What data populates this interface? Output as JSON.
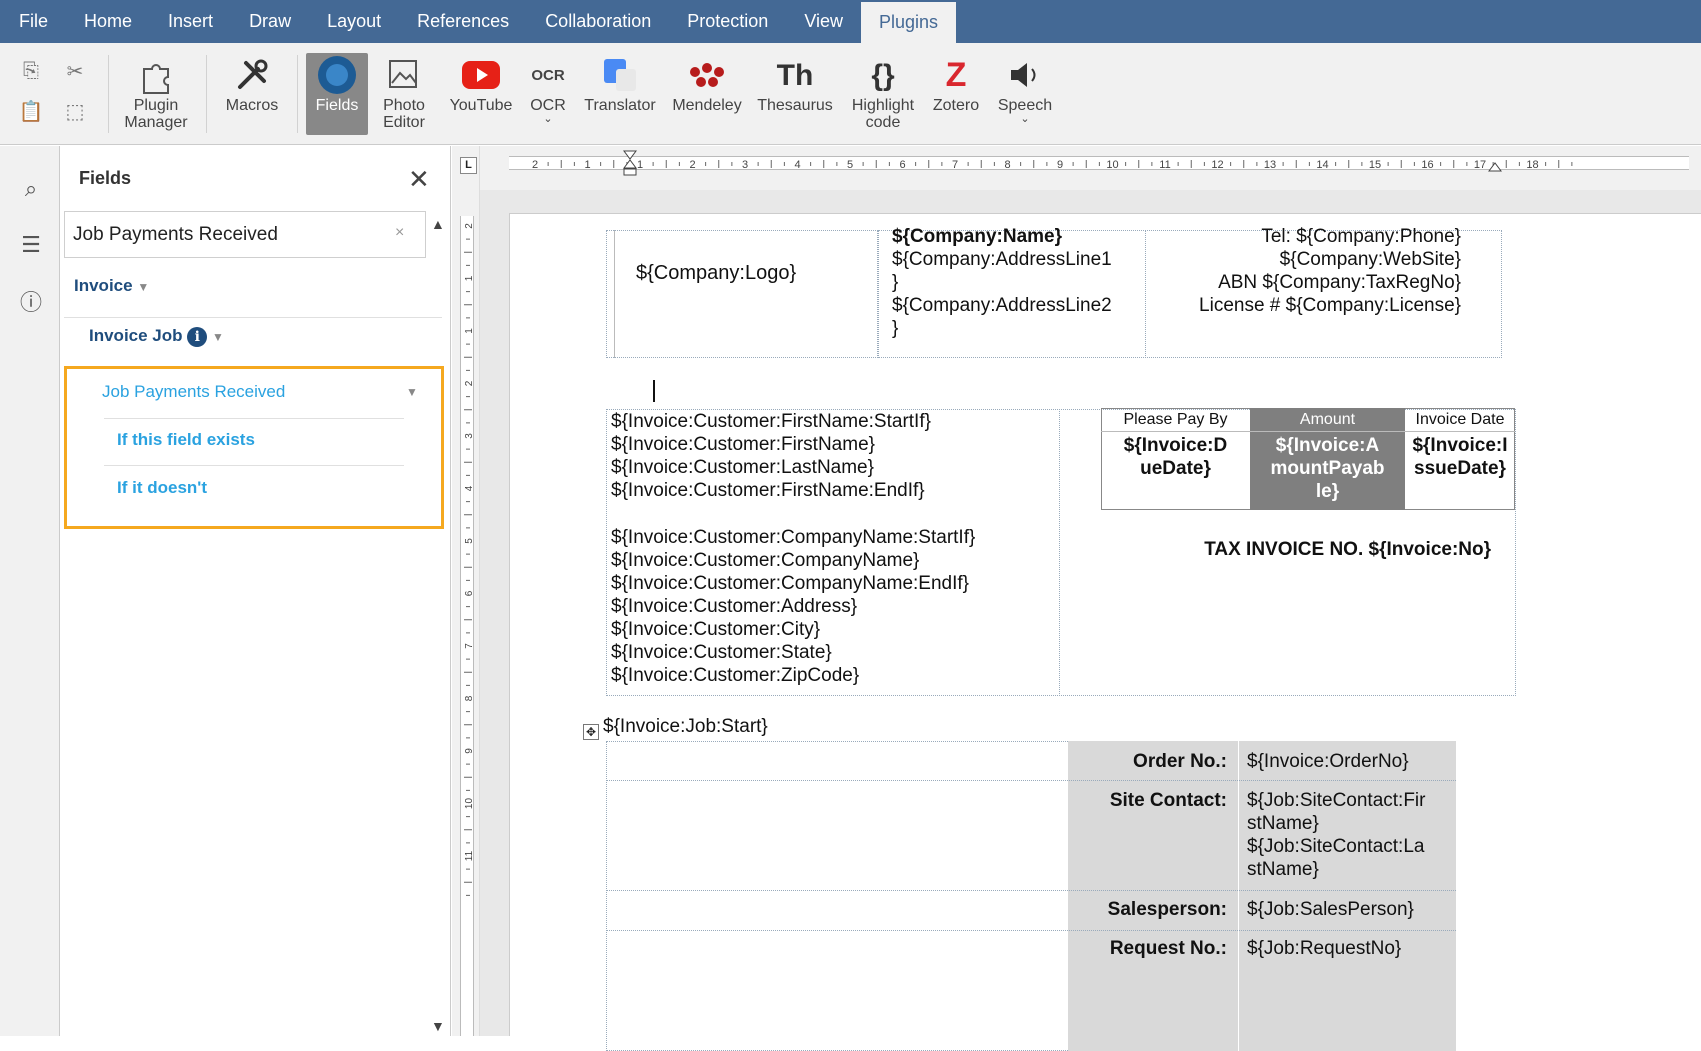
{
  "menu": {
    "tabs": [
      "File",
      "Home",
      "Insert",
      "Draw",
      "Layout",
      "References",
      "Collaboration",
      "Protection",
      "View",
      "Plugins"
    ],
    "active": "Plugins"
  },
  "toolbar": {
    "plugin_manager": "Plugin Manager",
    "macros": "Macros",
    "fields": "Fields",
    "photo_editor": "Photo Editor",
    "youtube": "YouTube",
    "ocr": "OCR",
    "translator": "Translator",
    "mendeley": "Mendeley",
    "thesaurus": "Thesaurus",
    "highlight_code": "Highlight code",
    "zotero": "Zotero",
    "speech": "Speech",
    "ocr_glyph": "OCR",
    "thesaurus_glyph": "Th",
    "highlight_glyph": "{}",
    "zotero_glyph": "Z"
  },
  "panel": {
    "title": "Fields",
    "search_value": "Job Payments Received",
    "tree": {
      "invoice": "Invoice",
      "invoice_job": "Invoice Job",
      "job_payments": "Job Payments Received",
      "if_exists": "If this field exists",
      "if_not": "If it doesn't"
    }
  },
  "ruler": {
    "corner": "L",
    "h_labels": [
      "2",
      "1",
      "1",
      "2",
      "3",
      "4",
      "5",
      "6",
      "7",
      "8",
      "9",
      "10",
      "11",
      "12",
      "13",
      "14",
      "15",
      "16",
      "17",
      "18"
    ],
    "v_labels": [
      "2",
      "1",
      "1",
      "2",
      "3",
      "4",
      "5",
      "6",
      "7",
      "8",
      "9",
      "10",
      "11"
    ]
  },
  "document": {
    "header": {
      "logo": "${Company:Logo}",
      "name": "${Company:Name}",
      "addr1a": "${Company:AddressLine1",
      "addr1b": "}",
      "addr2a": "${Company:AddressLine2",
      "addr2b": "}",
      "tel": "Tel: ${Company:Phone}",
      "web": "${Company:WebSite}",
      "abn": "ABN ${Company:TaxRegNo}",
      "license": "License # ${Company:License}"
    },
    "customer": [
      "${Invoice:Customer:FirstName:StartIf}",
      "${Invoice:Customer:FirstName}",
      "${Invoice:Customer:LastName}",
      "${Invoice:Customer:FirstName:EndIf}",
      "${Invoice:Customer:CompanyName:StartIf}",
      "${Invoice:Customer:CompanyName}",
      "${Invoice:Customer:CompanyName:EndIf}",
      "${Invoice:Customer:Address}",
      "${Invoice:Customer:City}",
      "${Invoice:Customer:State}",
      "${Invoice:Customer:ZipCode}"
    ],
    "pay_table": {
      "h_pay_by": "Please Pay By",
      "h_amount": "Amount",
      "h_date": "Invoice Date",
      "due_a": "${Invoice:D",
      "due_b": "ueDate}",
      "amt_a": "${Invoice:A",
      "amt_b": "mountPayab",
      "amt_c": "le}",
      "iss_a": "${Invoice:I",
      "iss_b": "ssueDate}"
    },
    "tax_invoice": "TAX INVOICE NO. ${Invoice:No}",
    "job_start": "${Invoice:Job:Start}",
    "job_table": {
      "order_label": "Order No.:",
      "order_value": "${Invoice:OrderNo}",
      "site_label": "Site Contact:",
      "site_v1": "${Job:SiteContact:Fir",
      "site_v2": "stName}",
      "site_v3": "${Job:SiteContact:La",
      "site_v4": "stName}",
      "sales_label": "Salesperson:",
      "sales_value": "${Job:SalesPerson}",
      "request_label": "Request No.:",
      "request_value": "${Job:RequestNo}"
    }
  },
  "colors": {
    "menubar": "#446995",
    "accent_blue": "#2aa2e0",
    "selection_orange": "#f5a81f",
    "amount_header": "#7f7f7f",
    "label_cell": "#d9d9d9"
  }
}
